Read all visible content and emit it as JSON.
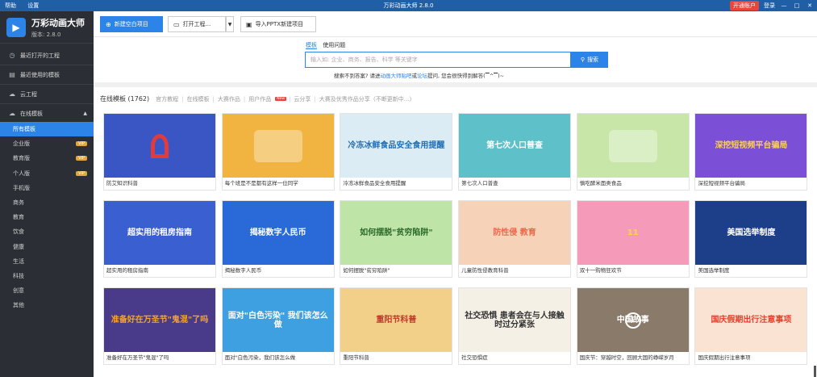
{
  "titlebar": {
    "menu": [
      "帮助",
      "设置"
    ],
    "title": "万彩动画大师 2.8.0",
    "vip_button": "开通账户",
    "login": "登录",
    "win_controls": [
      "—",
      "□",
      "✕"
    ]
  },
  "sidebar": {
    "app_name": "万彩动画大师",
    "version": "版本: 2.8.0",
    "main_items": [
      {
        "label": "最近打开的工程",
        "icon": "history-icon"
      },
      {
        "label": "最近使用的模板",
        "icon": "template-icon"
      },
      {
        "label": "云工程",
        "icon": "cloud-icon"
      },
      {
        "label": "在线模板",
        "icon": "cloud-template-icon"
      }
    ],
    "categories": [
      {
        "label": "所有模板",
        "vip": ""
      },
      {
        "label": "企业版",
        "vip": "VIP"
      },
      {
        "label": "教育版",
        "vip": "VIP"
      },
      {
        "label": "个人版",
        "vip": "VIP"
      },
      {
        "label": "手机版",
        "vip": ""
      },
      {
        "label": "商务",
        "vip": ""
      },
      {
        "label": "教育",
        "vip": ""
      },
      {
        "label": "饮食",
        "vip": ""
      },
      {
        "label": "健康",
        "vip": ""
      },
      {
        "label": "生活",
        "vip": ""
      },
      {
        "label": "科技",
        "vip": ""
      },
      {
        "label": "创意",
        "vip": ""
      },
      {
        "label": "其他",
        "vip": ""
      }
    ]
  },
  "toolbar": {
    "new_project": "新建空白项目",
    "open_project": "打开工程...",
    "import_pptx": "导入PPTX新建项目"
  },
  "search": {
    "tabs": [
      "模板",
      "使用问题"
    ],
    "placeholder": "输入如: 企业、商务、报告、科学 等关键字",
    "button": "搜索",
    "hint_prefix": "搜索不到答案? 请进",
    "hint_link1": "动画大师贴吧",
    "hint_mid": "或",
    "hint_link2": "论坛",
    "hint_suffix": "提问, 您会很快得到解答(▔^▔)~"
  },
  "filter": {
    "count": "在线模板 (1762)",
    "items": [
      "官方教程",
      "在线模板",
      "大赛作品",
      "用户作品",
      "云分享",
      "大赛及优秀作品分享（不断更新中...）"
    ],
    "new_tag": "New"
  },
  "colors": {
    "accent": "#2c84e8",
    "sidebar_bg": "#2b2f35",
    "titlebar_bg": "#1e5fa6"
  },
  "templates": [
    {
      "caption": "防艾知识科普",
      "text": "",
      "bg": "#3a55c4",
      "fg": "#ffffff",
      "icon": "red-ribbon-icon"
    },
    {
      "caption": "每个班是不是都有这样一位同学",
      "text": "",
      "bg": "#f2b440",
      "fg": "#333333",
      "icon": "students-icon"
    },
    {
      "caption": "冷冻冰鲜食品安全食用提醒",
      "text": "冷冻冰鲜食品安全食用提醒",
      "bg": "#dcecf5",
      "fg": "#1e6fb5",
      "icon": ""
    },
    {
      "caption": "第七次人口普查",
      "text": "第七次人口普查",
      "bg": "#5ec0c8",
      "fg": "#ffffff",
      "icon": ""
    },
    {
      "caption": "慎吃酵米面类食品",
      "text": "",
      "bg": "#c8e6a8",
      "fg": "#333333",
      "icon": "kitchen-icon"
    },
    {
      "caption": "深挖短视频平台骗局",
      "text": "深挖短视频平台骗局",
      "bg": "#7b4fd6",
      "fg": "#ffd23f",
      "icon": ""
    },
    {
      "caption": "超实用的租房指南",
      "text": "超实用的租房指南",
      "bg": "#3a5fd0",
      "fg": "#ffffff",
      "icon": ""
    },
    {
      "caption": "揭秘数字人民币",
      "text": "揭秘数字人民币",
      "bg": "#2a6ad8",
      "fg": "#ffffff",
      "icon": ""
    },
    {
      "caption": "如何摆脱\"贫穷陷阱\"",
      "text": "如何摆脱\"贫穷陷阱\"",
      "bg": "#bfe4a8",
      "fg": "#2a6a2a",
      "icon": ""
    },
    {
      "caption": "儿童防性侵教育科普",
      "text": "防性侵 教育",
      "bg": "#f6d2b8",
      "fg": "#e96a4a",
      "icon": ""
    },
    {
      "caption": "双十一购物狂欢节",
      "text": "11",
      "bg": "#f59ab8",
      "fg": "#ffd54a",
      "icon": ""
    },
    {
      "caption": "美国选举制度",
      "text": "美国选举制度",
      "bg": "#1d3f8a",
      "fg": "#ffffff",
      "icon": ""
    },
    {
      "caption": "准备好在万圣节\"鬼混\"了吗",
      "text": "准备好在万圣节\"鬼混\"了吗",
      "bg": "#4a3a8a",
      "fg": "#f5a623",
      "icon": ""
    },
    {
      "caption": "面对\"白色污染，我们该怎么做",
      "text": "面对\"白色污染\" 我们该怎么做",
      "bg": "#3ea0e0",
      "fg": "#ffffff",
      "icon": ""
    },
    {
      "caption": "重阳节科普",
      "text": "重阳节科普",
      "bg": "#f2d08a",
      "fg": "#c0392b",
      "icon": ""
    },
    {
      "caption": "社交恐惧症",
      "text": "社交恐惧 患者会在与人接触时过分紧张",
      "bg": "#f5f0e6",
      "fg": "#333333",
      "icon": ""
    },
    {
      "caption": "国庆节：穿越时空，回顾大国的峥嵘岁月",
      "text": "中国故事",
      "bg": "#8a7a6a",
      "fg": "#ffffff",
      "icon": "play-icon"
    },
    {
      "caption": "国庆假期出行注意事项",
      "text": "国庆假期出行注意事项",
      "bg": "#fbe3d4",
      "fg": "#e6402a",
      "icon": ""
    }
  ]
}
